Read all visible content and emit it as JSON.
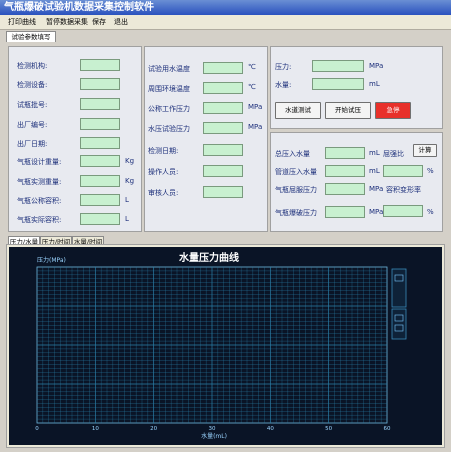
{
  "window": {
    "title": "气瓶爆破试验机数据采集控制软件"
  },
  "menu": [
    "打印曲线",
    "暂停数据采集",
    "保存",
    "退出"
  ],
  "top_tab": "试验参数填写",
  "left_fields": [
    "检测机构:",
    "检测设备:",
    "试瓶批号:",
    "出厂编号:",
    "出厂日期:",
    "气瓶设计重量:",
    "气瓶实测重量:",
    "气瓶公称容积:",
    "气瓶实际容积:"
  ],
  "left_units": {
    "design_weight": "Kg",
    "measured_weight": "Kg",
    "nominal_volume": "L",
    "actual_volume": "L"
  },
  "mid_fields": [
    "试验用水温度",
    "周围环境温度",
    "公称工作压力",
    "水压试验压力",
    "检测日期:",
    "操作人员:",
    "审核人员:"
  ],
  "mid_units": {
    "water_temp": "℃",
    "ambient_temp": "℃",
    "work_pressure": "MPa",
    "test_pressure": "MPa"
  },
  "right_top": {
    "pressure_label": "压力:",
    "pressure_unit": "MPa",
    "water_label": "水量:",
    "water_unit": "mL"
  },
  "buttons": {
    "water_test": "水道测试",
    "start": "开始试压",
    "stop": "急停",
    "calc": "计算"
  },
  "results": {
    "total_water_label": "总压入水量",
    "total_water_unit": "mL",
    "pipe_water_label": "管道压入水量",
    "pipe_water_unit": "mL",
    "yield_pressure_label": "气瓶屈服压力",
    "yield_pressure_unit": "MPa",
    "burst_pressure_label": "气瓶爆破压力",
    "burst_pressure_unit": "MPa",
    "yield_ratio_label": "屈强比",
    "volume_change_label": "容积变形率",
    "percent": "%"
  },
  "chart_tabs": [
    "压力/水量",
    "压力/时间",
    "水量/时间"
  ],
  "chart_data": {
    "type": "line",
    "title": "水量压力曲线",
    "ylabel": "压力(MPa)",
    "xlabel": "水量(mL)",
    "xlim": [
      0,
      60
    ],
    "x_ticks": [
      0,
      10,
      20,
      30,
      40,
      50,
      60
    ],
    "series": [],
    "grid": true
  },
  "colors": {
    "chart_bg": "#0a1426",
    "grid": "#2a7fa8",
    "accent_green": "#c8f0d0",
    "stop_button": "#e8302a"
  }
}
